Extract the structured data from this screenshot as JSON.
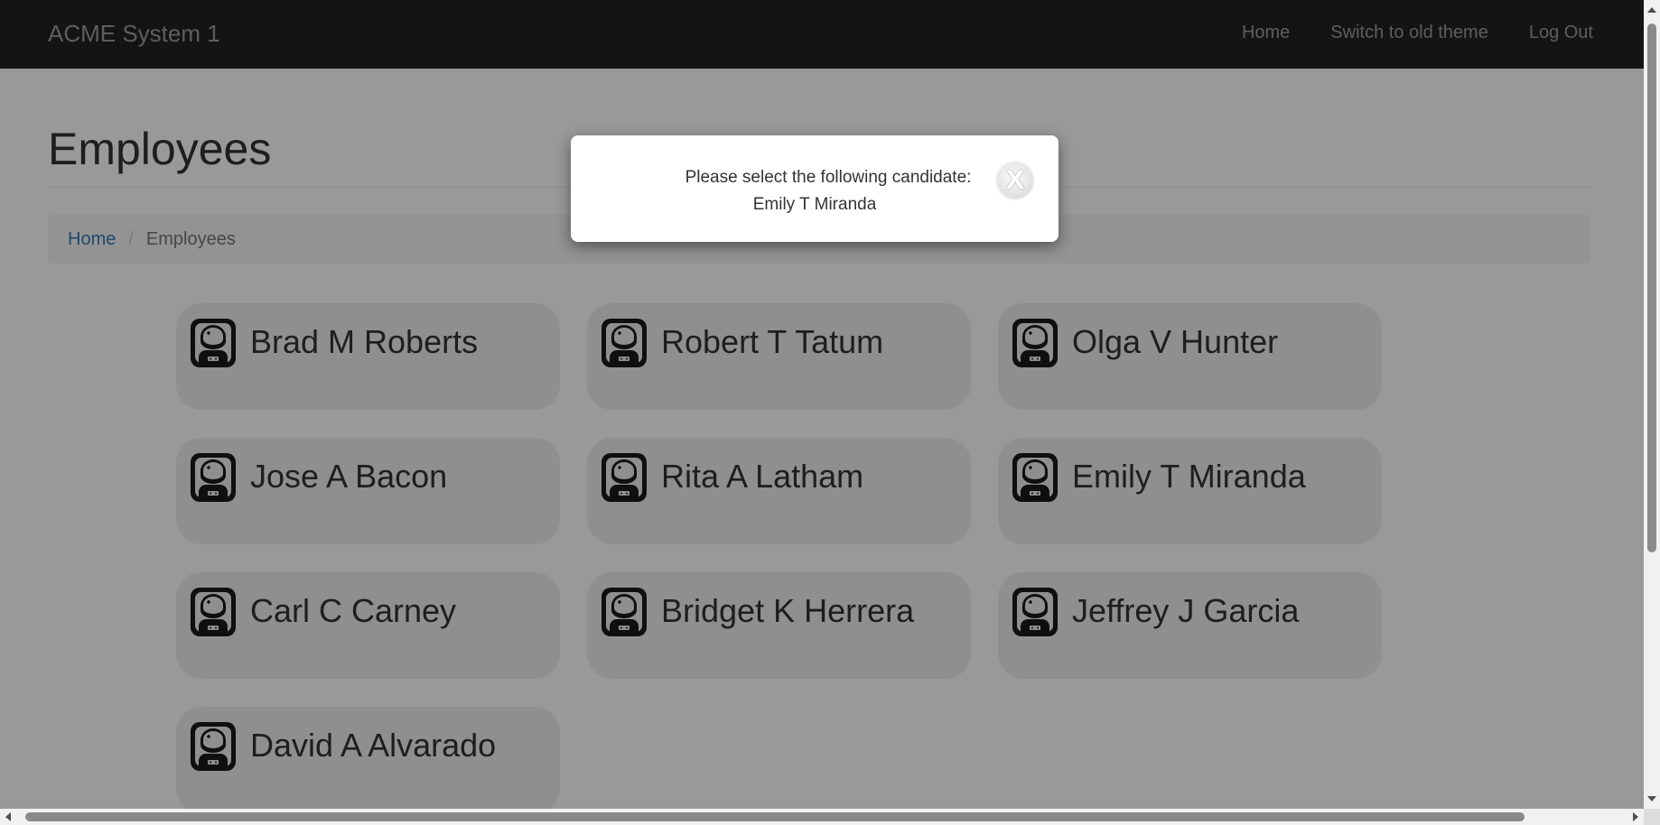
{
  "navbar": {
    "brand": "ACME System 1",
    "links": [
      "Home",
      "Switch to old theme",
      "Log Out"
    ]
  },
  "page": {
    "title": "Employees",
    "breadcrumb": {
      "home": "Home",
      "separator": "/",
      "current": "Employees"
    }
  },
  "employees": [
    "Brad M Roberts",
    "Robert T Tatum",
    "Olga V Hunter",
    "Jose A Bacon",
    "Rita A Latham",
    "Emily T Miranda",
    "Carl C Carney",
    "Bridget K Herrera",
    "Jeffrey J Garcia",
    "David A Alvarado"
  ],
  "employee_icon": "astronaut-avatar-icon",
  "modal": {
    "line1": "Please select the following candidate:",
    "line2": "Emily T Miranda",
    "close_label": "X"
  },
  "colors": {
    "navbar_bg": "#222222",
    "link": "#337ab7",
    "card_bg": "#efefef"
  }
}
